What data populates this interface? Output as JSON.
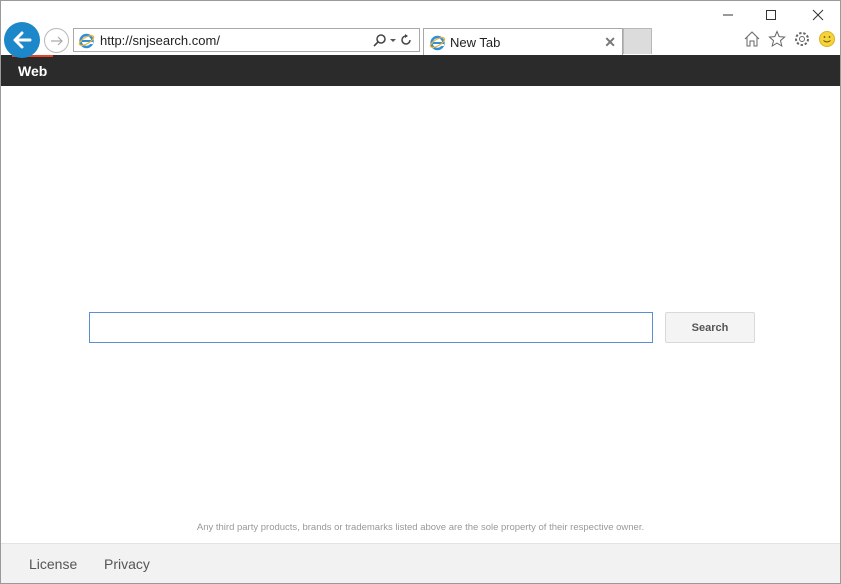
{
  "browser": {
    "window_controls": {
      "minimize": "—",
      "maximize": "☐",
      "close": "✕"
    },
    "address_url": "http://snjsearch.com/",
    "tab": {
      "title": "New Tab",
      "close_glyph": "✕"
    },
    "toolbar_icons": [
      "home-icon",
      "favorites-star-icon",
      "settings-gear-icon",
      "feedback-smiley-icon"
    ],
    "accent_color": "#1c87c9"
  },
  "site": {
    "nav": {
      "items": [
        {
          "label": "Web",
          "active": true
        }
      ],
      "background": "#2b2b2b",
      "active_color": "#e4432e"
    },
    "search": {
      "input_value": "",
      "placeholder": "",
      "button_label": "Search"
    },
    "disclaimer": "Any third party products, brands or trademarks listed above are the sole property of their respective owner.",
    "footer": {
      "links": [
        {
          "label": "License"
        },
        {
          "label": "Privacy"
        }
      ]
    }
  }
}
